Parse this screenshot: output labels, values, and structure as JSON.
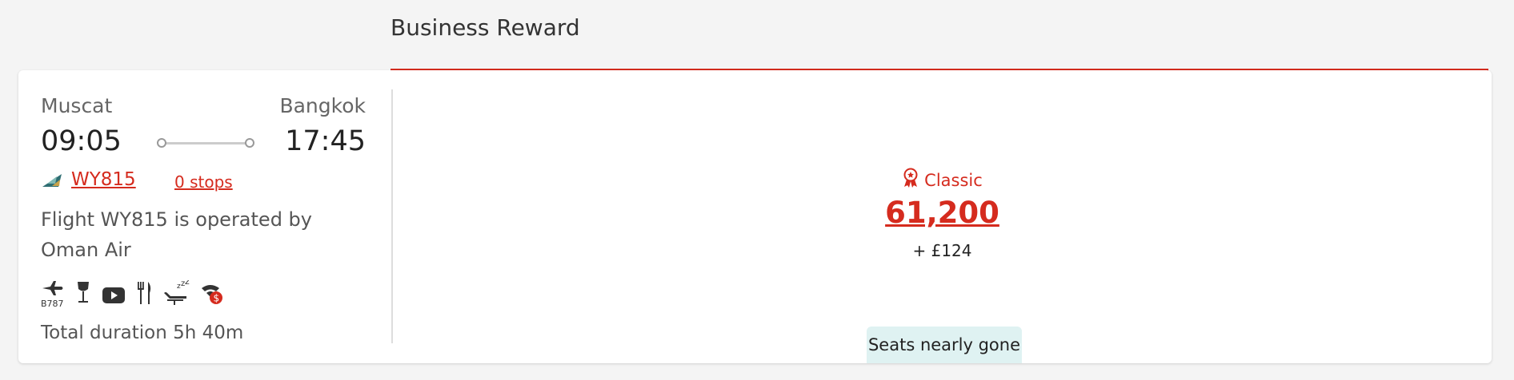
{
  "cabin": {
    "title": "Business Reward"
  },
  "flight": {
    "origin_city": "Muscat",
    "destination_city": "Bangkok",
    "departure_time": "09:05",
    "arrival_time": "17:45",
    "flight_number": "WY815",
    "stops_label": "0 stops",
    "operated_by": "Flight WY815 is operated by Oman Air",
    "aircraft_code": "B787",
    "total_duration": "Total duration 5h 40m",
    "amenities": [
      "aircraft-icon",
      "wine-glass-icon",
      "video-play-icon",
      "dining-utensils-icon",
      "flat-bed-sleep-icon",
      "paid-wifi-icon"
    ]
  },
  "fare": {
    "type_label": "Classic",
    "miles": "61,200",
    "tax": "+ £124",
    "availability": "Seats nearly gone"
  },
  "colors": {
    "accent": "#d52b1e",
    "badge_bg": "#dff2f2",
    "page_bg": "#f4f4f4"
  }
}
